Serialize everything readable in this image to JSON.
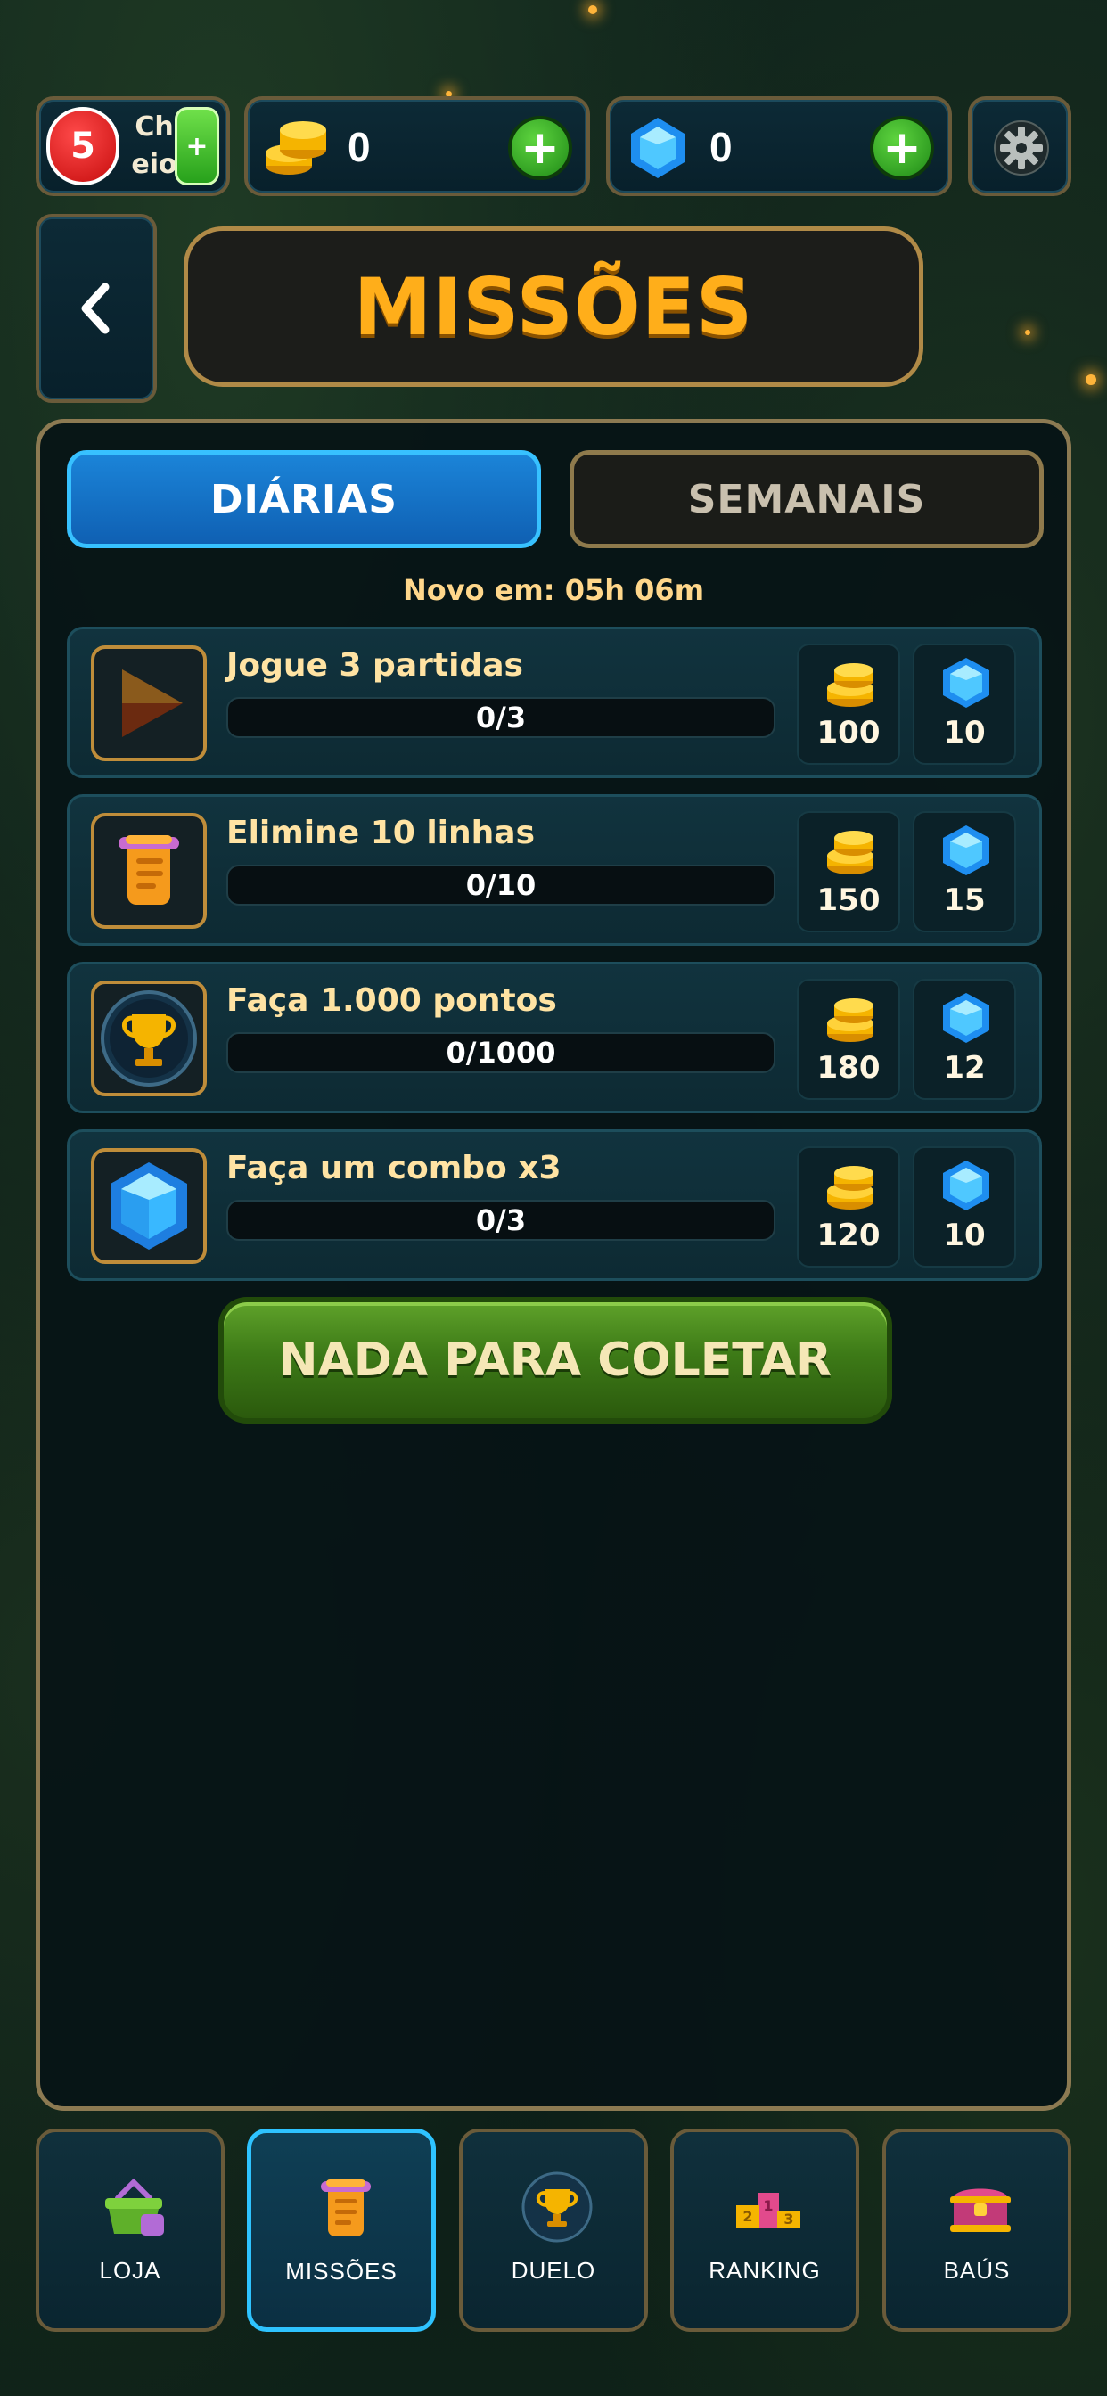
{
  "status": {
    "lives_count": "5",
    "lives_label": "Cheio",
    "lives_add": "+",
    "coins_value": "0",
    "gems_value": "0",
    "add_symbol": "+"
  },
  "header": {
    "title": "MISSÕES"
  },
  "tabs": {
    "daily": "DIÁRIAS",
    "weekly": "SEMANAIS"
  },
  "timer": "Novo em: 05h 06m",
  "missions": [
    {
      "title": "Jogue 3 partidas",
      "progress": "0/3",
      "progress_fraction": 0,
      "coins": "100",
      "gems": "10",
      "icon": "play-icon"
    },
    {
      "title": "Elimine 10 linhas",
      "progress": "0/10",
      "progress_fraction": 0,
      "coins": "150",
      "gems": "15",
      "icon": "scroll-icon"
    },
    {
      "title": "Faça 1.000 pontos",
      "progress": "0/1000",
      "progress_fraction": 0,
      "coins": "180",
      "gems": "12",
      "icon": "trophy-icon"
    },
    {
      "title": "Faça um combo x3",
      "progress": "0/3",
      "progress_fraction": 0,
      "coins": "120",
      "gems": "10",
      "icon": "gem-icon"
    }
  ],
  "collect_button": "NADA PARA COLETAR",
  "nav": [
    {
      "label": "LOJA",
      "icon": "shop-basket-icon",
      "active": false
    },
    {
      "label": "MISSÕES",
      "icon": "scroll-icon",
      "active": true
    },
    {
      "label": "DUELO",
      "icon": "trophy-icon",
      "active": false
    },
    {
      "label": "RANKING",
      "icon": "podium-icon",
      "active": false
    },
    {
      "label": "BAÚS",
      "icon": "chest-icon",
      "active": false
    }
  ],
  "colors": {
    "accent_orange": "#ffae1a",
    "tab_active_blue": "#1b84d8",
    "nav_active_border": "#2ec3ff",
    "button_green": "#3d7a17"
  }
}
